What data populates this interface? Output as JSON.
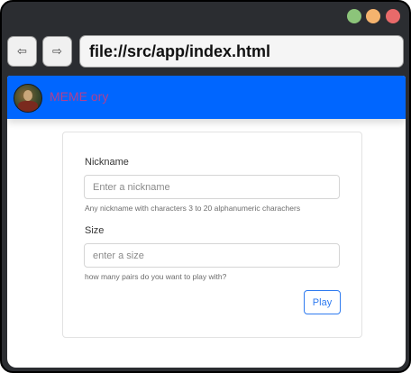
{
  "window": {
    "controls": [
      {
        "name": "maximize",
        "color": "#8cc47a"
      },
      {
        "name": "minimize",
        "color": "#f5b36e"
      },
      {
        "name": "close",
        "color": "#e86a6a"
      }
    ]
  },
  "browser": {
    "back_icon": "⇦",
    "forward_icon": "⇨",
    "address": "file://src/app/index.html"
  },
  "appbar": {
    "brand": "MEME ory",
    "color": "#0066ff",
    "avatar_icon": "avatar-icon"
  },
  "form": {
    "nickname": {
      "label": "Nickname",
      "placeholder": "Enter a nickname",
      "value": "",
      "help": "Any nickname with characters 3 to 20 alphanumeric charachers"
    },
    "size": {
      "label": "Size",
      "placeholder": "enter a size",
      "value": "",
      "help": "how many pairs do you want to play with?"
    },
    "submit_label": "Play",
    "accent": "#2f7bf0"
  }
}
